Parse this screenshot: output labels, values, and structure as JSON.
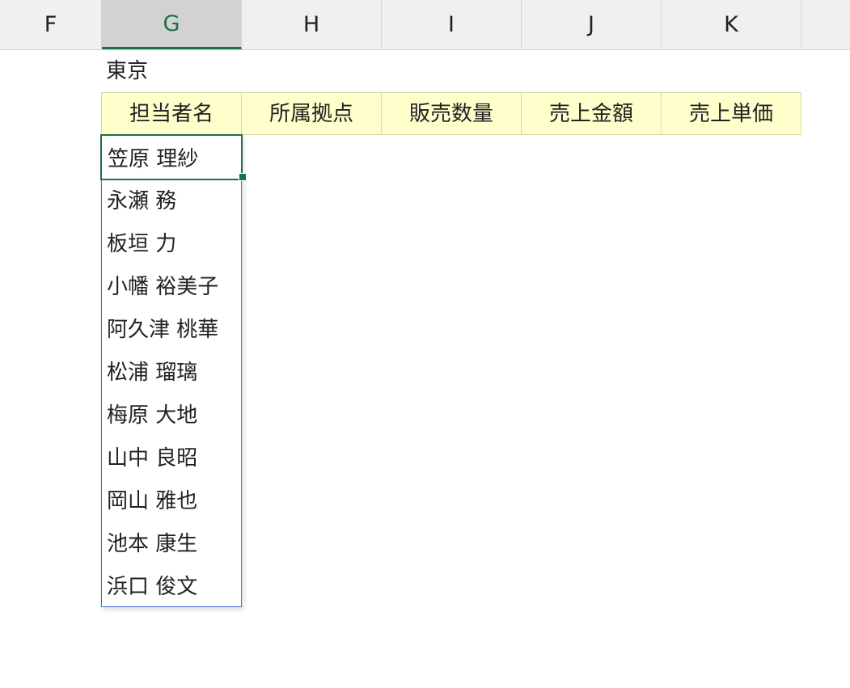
{
  "columns": [
    {
      "label": "F"
    },
    {
      "label": "G",
      "selected": true
    },
    {
      "label": "H"
    },
    {
      "label": "I"
    },
    {
      "label": "J"
    },
    {
      "label": "K"
    }
  ],
  "sheet": {
    "title": "東京",
    "headers": [
      "担当者名",
      "所属拠点",
      "販売数量",
      "売上金額",
      "売上単価"
    ]
  },
  "dropdown": {
    "items": [
      "笠原 理紗",
      "永瀬 務",
      "板垣 力",
      "小幡 裕美子",
      "阿久津 桃華",
      "松浦 瑠璃",
      "梅原 大地",
      "山中 良昭",
      "岡山 雅也",
      "池本 康生",
      "浜口 俊文"
    ]
  },
  "colors": {
    "accent": "#1e7145",
    "header_fill": "#ffffcc",
    "list_border": "#4a6fd0"
  }
}
